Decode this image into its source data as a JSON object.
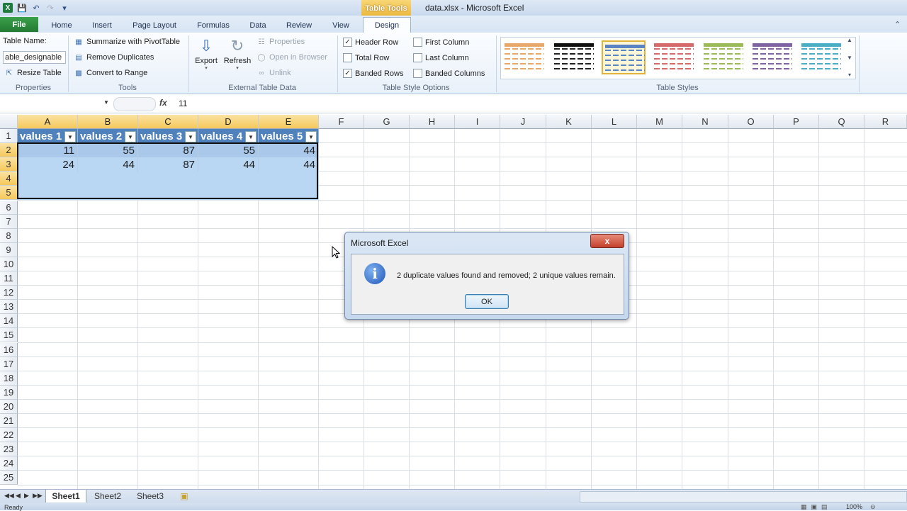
{
  "window": {
    "title": "data.xlsx  -  Microsoft Excel",
    "context_tab": "Table Tools",
    "logo": "X"
  },
  "tabs": [
    "File",
    "Home",
    "Insert",
    "Page Layout",
    "Formulas",
    "Data",
    "Review",
    "View",
    "Design"
  ],
  "ribbon": {
    "properties": {
      "table_name_label": "Table Name:",
      "table_name_value": "able_designable",
      "resize": "Resize Table",
      "group": "Properties"
    },
    "tools": {
      "pivot": "Summarize with PivotTable",
      "dups": "Remove Duplicates",
      "range": "Convert to Range",
      "group": "Tools"
    },
    "external": {
      "export": "Export",
      "refresh": "Refresh",
      "properties": "Properties",
      "open": "Open in Browser",
      "unlink": "Unlink",
      "group": "External Table Data"
    },
    "options": {
      "header_row": "Header Row",
      "total_row": "Total Row",
      "banded_rows": "Banded Rows",
      "first_col": "First Column",
      "last_col": "Last Column",
      "banded_cols": "Banded Columns",
      "group": "Table Style Options"
    },
    "styles": {
      "group": "Table Styles",
      "swatches": [
        "#e8a86a",
        "#111111",
        "#5b84c2",
        "#d46a6a",
        "#9bbb59",
        "#8064a2",
        "#4bacc6"
      ]
    }
  },
  "formula_bar": {
    "name_box": "",
    "fx": "fx",
    "value": "11"
  },
  "columns": [
    "A",
    "B",
    "C",
    "D",
    "E",
    "F",
    "G",
    "H",
    "I",
    "J",
    "K",
    "L",
    "M",
    "N",
    "O",
    "P",
    "Q",
    "R"
  ],
  "rows": [
    "1",
    "2",
    "3",
    "4",
    "5",
    "6",
    "7",
    "8",
    "9",
    "10",
    "11",
    "12",
    "13",
    "14",
    "15",
    "16",
    "17",
    "18",
    "19",
    "20",
    "21",
    "22",
    "23",
    "24",
    "25"
  ],
  "table": {
    "headers": [
      "values 1",
      "values 2",
      "values 3",
      "values 4",
      "values 5"
    ],
    "data": [
      [
        "11",
        "55",
        "87",
        "55",
        "44"
      ],
      [
        "24",
        "44",
        "87",
        "44",
        "44"
      ]
    ]
  },
  "dialog": {
    "title": "Microsoft Excel",
    "message": "2 duplicate values found and removed; 2 unique values remain.",
    "ok": "OK",
    "close": "x"
  },
  "sheets": [
    "Sheet1",
    "Sheet2",
    "Sheet3"
  ],
  "status": {
    "ready": "Ready",
    "zoom": "100%"
  }
}
